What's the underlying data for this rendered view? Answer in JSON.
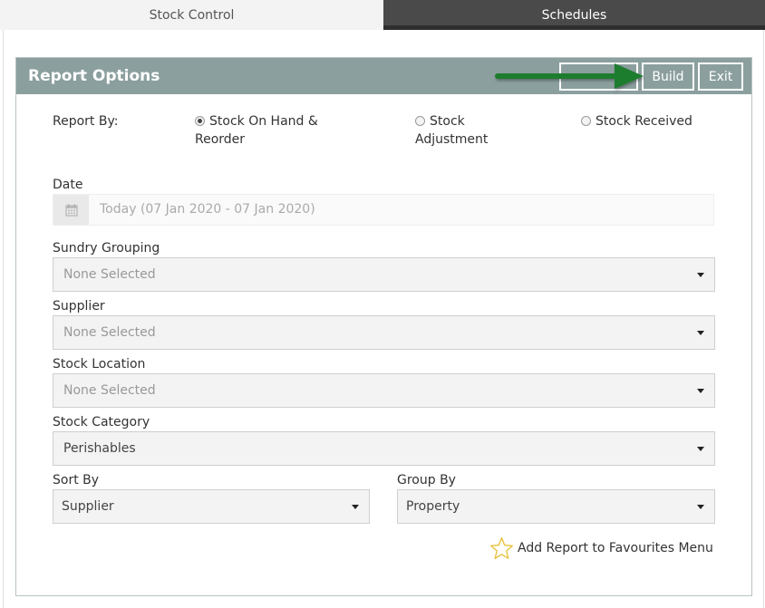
{
  "tabs": [
    {
      "label": "Stock Control"
    },
    {
      "label": "Schedules"
    }
  ],
  "panel": {
    "title": "Report Options",
    "buttons": {
      "hidden": "",
      "build": "Build",
      "exit": "Exit"
    }
  },
  "report_by": {
    "label": "Report By:",
    "options": [
      {
        "line1": "Stock On Hand &",
        "line2": "Reorder",
        "checked": true
      },
      {
        "line1": "Stock",
        "line2": "Adjustment",
        "checked": false
      },
      {
        "line1": "Stock Received",
        "line2": "",
        "checked": false
      }
    ]
  },
  "date": {
    "label": "Date",
    "value": "Today (07 Jan 2020 - 07 Jan 2020)"
  },
  "fields": {
    "sundry_grouping": {
      "label": "Sundry Grouping",
      "value": "None Selected"
    },
    "supplier": {
      "label": "Supplier",
      "value": "None Selected"
    },
    "stock_location": {
      "label": "Stock Location",
      "value": "None Selected"
    },
    "stock_category": {
      "label": "Stock Category",
      "value": "Perishables"
    },
    "sort_by": {
      "label": "Sort By",
      "value": "Supplier"
    },
    "group_by": {
      "label": "Group By",
      "value": "Property"
    }
  },
  "favourites": {
    "label": "Add Report to Favourites Menu"
  },
  "colors": {
    "header": "#8c9f9f",
    "arrow": "#1e7d2e",
    "star": "#e6c23a",
    "active_tab": "#4a4a4a"
  }
}
